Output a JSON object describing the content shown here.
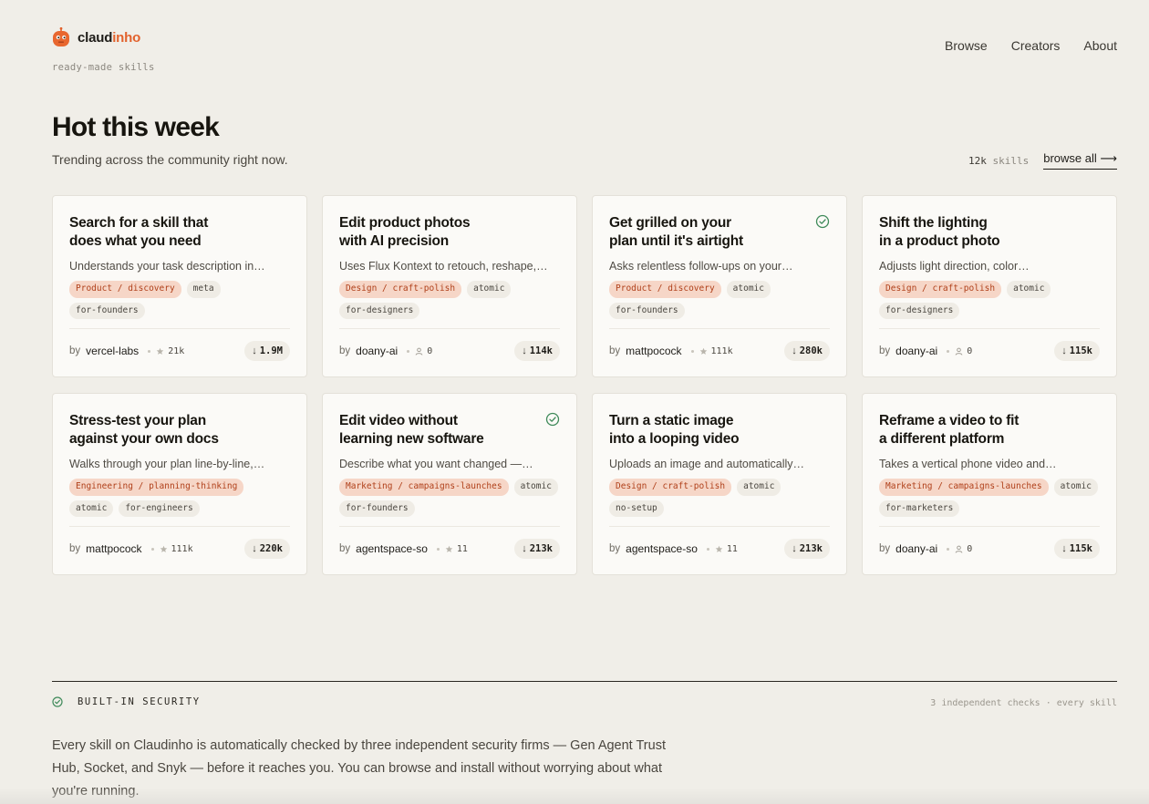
{
  "brand": {
    "name_part1": "claud",
    "name_part2": "inho",
    "tagline": "ready-made skills",
    "accent": "#e2622d"
  },
  "nav": [
    {
      "label": "Browse"
    },
    {
      "label": "Creators"
    },
    {
      "label": "About"
    }
  ],
  "hero": {
    "title": "Hot this week",
    "subtitle": "Trending across the community right now.",
    "skill_count_value": "12k",
    "skill_count_unit": "skills",
    "browse_all": "browse all ⟶"
  },
  "cards": [
    {
      "title": "Search for a skill that\ndoes what you need",
      "desc": "Understands your task description in…",
      "verified": false,
      "tags": [
        {
          "label": "Product / discovery",
          "kind": "category"
        },
        {
          "label": "meta"
        },
        {
          "label": "for-founders"
        }
      ],
      "by": "by",
      "author": "vercel-labs",
      "stat_icon": "star-icon",
      "stat": "21k",
      "downloads": "1.9M"
    },
    {
      "title": "Edit product photos\nwith AI precision",
      "desc": "Uses Flux Kontext to retouch, reshape,…",
      "verified": false,
      "tags": [
        {
          "label": "Design / craft-polish",
          "kind": "category"
        },
        {
          "label": "atomic"
        },
        {
          "label": "for-designers"
        }
      ],
      "by": "by",
      "author": "doany-ai",
      "stat_icon": "user-icon",
      "stat": "0",
      "downloads": "114k"
    },
    {
      "title": "Get grilled on your\nplan until it's airtight",
      "desc": "Asks relentless follow-ups on your…",
      "verified": true,
      "tags": [
        {
          "label": "Product / discovery",
          "kind": "category"
        },
        {
          "label": "atomic"
        },
        {
          "label": "for-founders"
        }
      ],
      "by": "by",
      "author": "mattpocock",
      "stat_icon": "star-icon",
      "stat": "111k",
      "downloads": "280k"
    },
    {
      "title": "Shift the lighting\nin a product photo",
      "desc": "Adjusts light direction, color…",
      "verified": false,
      "tags": [
        {
          "label": "Design / craft-polish",
          "kind": "category"
        },
        {
          "label": "atomic"
        },
        {
          "label": "for-designers"
        }
      ],
      "by": "by",
      "author": "doany-ai",
      "stat_icon": "user-icon",
      "stat": "0",
      "downloads": "115k"
    },
    {
      "title": "Stress-test your plan\nagainst your own docs",
      "desc": "Walks through your plan line-by-line,…",
      "verified": false,
      "tags": [
        {
          "label": "Engineering / planning-thinking",
          "kind": "category"
        },
        {
          "label": "atomic"
        },
        {
          "label": "for-engineers"
        }
      ],
      "by": "by",
      "author": "mattpocock",
      "stat_icon": "star-icon",
      "stat": "111k",
      "downloads": "220k"
    },
    {
      "title": "Edit video without\nlearning new software",
      "desc": "Describe what you want changed —…",
      "verified": true,
      "tags": [
        {
          "label": "Marketing / campaigns-launches",
          "kind": "category"
        },
        {
          "label": "atomic"
        },
        {
          "label": "for-founders"
        }
      ],
      "by": "by",
      "author": "agentspace-so",
      "stat_icon": "star-icon",
      "stat": "11",
      "downloads": "213k"
    },
    {
      "title": "Turn a static image\ninto a looping video",
      "desc": "Uploads an image and automatically…",
      "verified": false,
      "tags": [
        {
          "label": "Design / craft-polish",
          "kind": "category"
        },
        {
          "label": "atomic"
        },
        {
          "label": "no-setup"
        }
      ],
      "by": "by",
      "author": "agentspace-so",
      "stat_icon": "star-icon",
      "stat": "11",
      "downloads": "213k"
    },
    {
      "title": "Reframe a video to fit\na different platform",
      "desc": "Takes a vertical phone video and…",
      "verified": false,
      "tags": [
        {
          "label": "Marketing / campaigns-launches",
          "kind": "category"
        },
        {
          "label": "atomic"
        },
        {
          "label": "for-marketers"
        }
      ],
      "by": "by",
      "author": "doany-ai",
      "stat_icon": "user-icon",
      "stat": "0",
      "downloads": "115k"
    }
  ],
  "security": {
    "label": "BUILT-IN SECURITY",
    "right": "3 independent checks · every skill",
    "body": "Every skill on Claudinho is automatically checked by three independent security firms — Gen Agent Trust Hub, Socket, and Snyk — before it reaches you. You can browse and install without worrying about what you're running."
  }
}
